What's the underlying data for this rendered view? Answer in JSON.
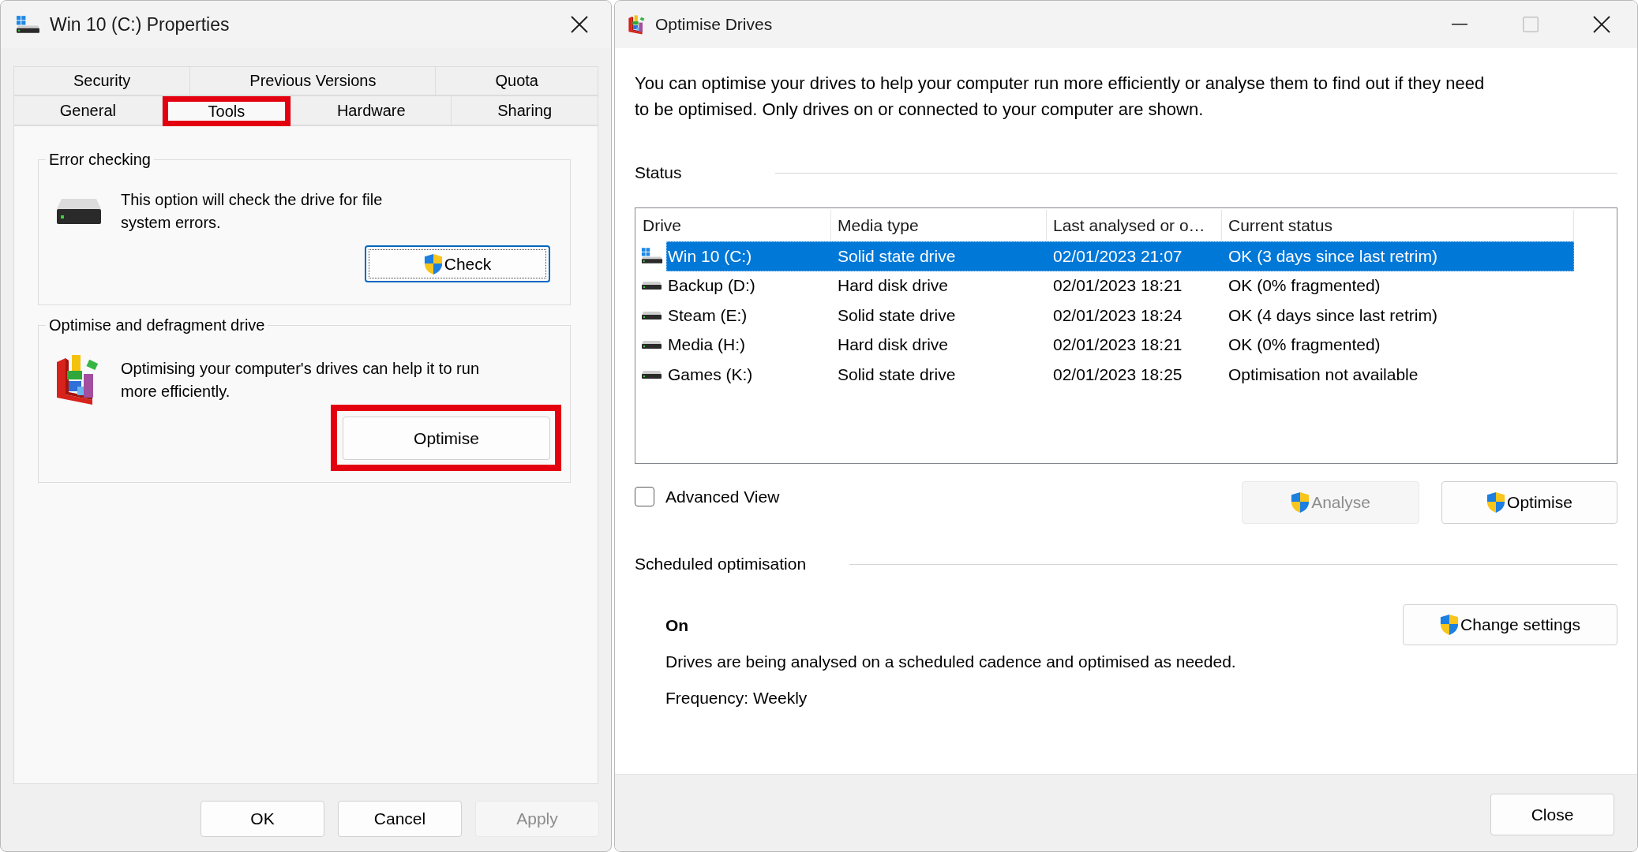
{
  "properties_dialog": {
    "title": "Win 10 (C:) Properties",
    "tab_rows": [
      {
        "tabs": [
          {
            "label": "Security",
            "selected": false,
            "highlighted": false
          },
          {
            "label": "Previous Versions",
            "selected": false,
            "highlighted": false
          },
          {
            "label": "Quota",
            "selected": false,
            "highlighted": false
          }
        ]
      },
      {
        "tabs": [
          {
            "label": "General",
            "selected": false,
            "highlighted": false
          },
          {
            "label": "Tools",
            "selected": true,
            "highlighted": true
          },
          {
            "label": "Hardware",
            "selected": false,
            "highlighted": false
          },
          {
            "label": "Sharing",
            "selected": false,
            "highlighted": false
          }
        ]
      }
    ],
    "groups": [
      {
        "kind": "drive",
        "title": "Error checking",
        "text": "This option will check the drive for file system errors.",
        "button": {
          "label": "Check",
          "elevated": true,
          "focused": true,
          "highlighted": false
        }
      },
      {
        "kind": "defrag",
        "title": "Optimise and defragment drive",
        "text": "Optimising your computer's drives can help it to run more efficiently.",
        "button": {
          "label": "Optimise",
          "elevated": false,
          "focused": false,
          "highlighted": true
        }
      }
    ],
    "buttons": [
      {
        "label": "OK",
        "disabled": false
      },
      {
        "label": "Cancel",
        "disabled": false
      },
      {
        "label": "Apply",
        "disabled": true
      }
    ]
  },
  "optimise_window": {
    "title": "Optimise Drives",
    "window_controls": [
      {
        "kind": "minimize",
        "disabled": false
      },
      {
        "kind": "maximize",
        "disabled": true
      },
      {
        "kind": "close",
        "disabled": false
      }
    ],
    "description": "You can optimise your drives to help your computer run more efficiently or analyse them to find out if they need to be optimised. Only drives on or connected to your computer are shown.",
    "status_heading": "Status",
    "table": {
      "columns": [
        "Drive",
        "Media type",
        "Last analysed or o…",
        "Current status"
      ],
      "rows": [
        {
          "kind": "system",
          "selected": true,
          "cells": [
            "Win 10 (C:)",
            "Solid state drive",
            "02/01/2023 21:07",
            "OK (3 days since last retrim)"
          ]
        },
        {
          "kind": "drive",
          "selected": false,
          "cells": [
            "Backup (D:)",
            "Hard disk drive",
            "02/01/2023 18:21",
            "OK (0% fragmented)"
          ]
        },
        {
          "kind": "drive",
          "selected": false,
          "cells": [
            "Steam (E:)",
            "Solid state drive",
            "02/01/2023 18:24",
            "OK (4 days since last retrim)"
          ]
        },
        {
          "kind": "drive",
          "selected": false,
          "cells": [
            "Media (H:)",
            "Hard disk drive",
            "02/01/2023 18:21",
            "OK (0% fragmented)"
          ]
        },
        {
          "kind": "drive",
          "selected": false,
          "cells": [
            "Games (K:)",
            "Solid state drive",
            "02/01/2023 18:25",
            "Optimisation not available"
          ]
        }
      ]
    },
    "advanced_view": {
      "label": "Advanced View",
      "checked": false
    },
    "actions": [
      {
        "label": "Analyse",
        "elevated": true,
        "disabled": true
      },
      {
        "label": "Optimise",
        "elevated": true,
        "disabled": false
      }
    ],
    "schedule": {
      "heading": "Scheduled optimisation",
      "state": "On",
      "description": "Drives are being analysed on a scheduled cadence and optimised as needed.",
      "frequency": "Frequency: Weekly",
      "button": {
        "label": "Change settings",
        "elevated": true
      }
    },
    "close_button": "Close"
  }
}
